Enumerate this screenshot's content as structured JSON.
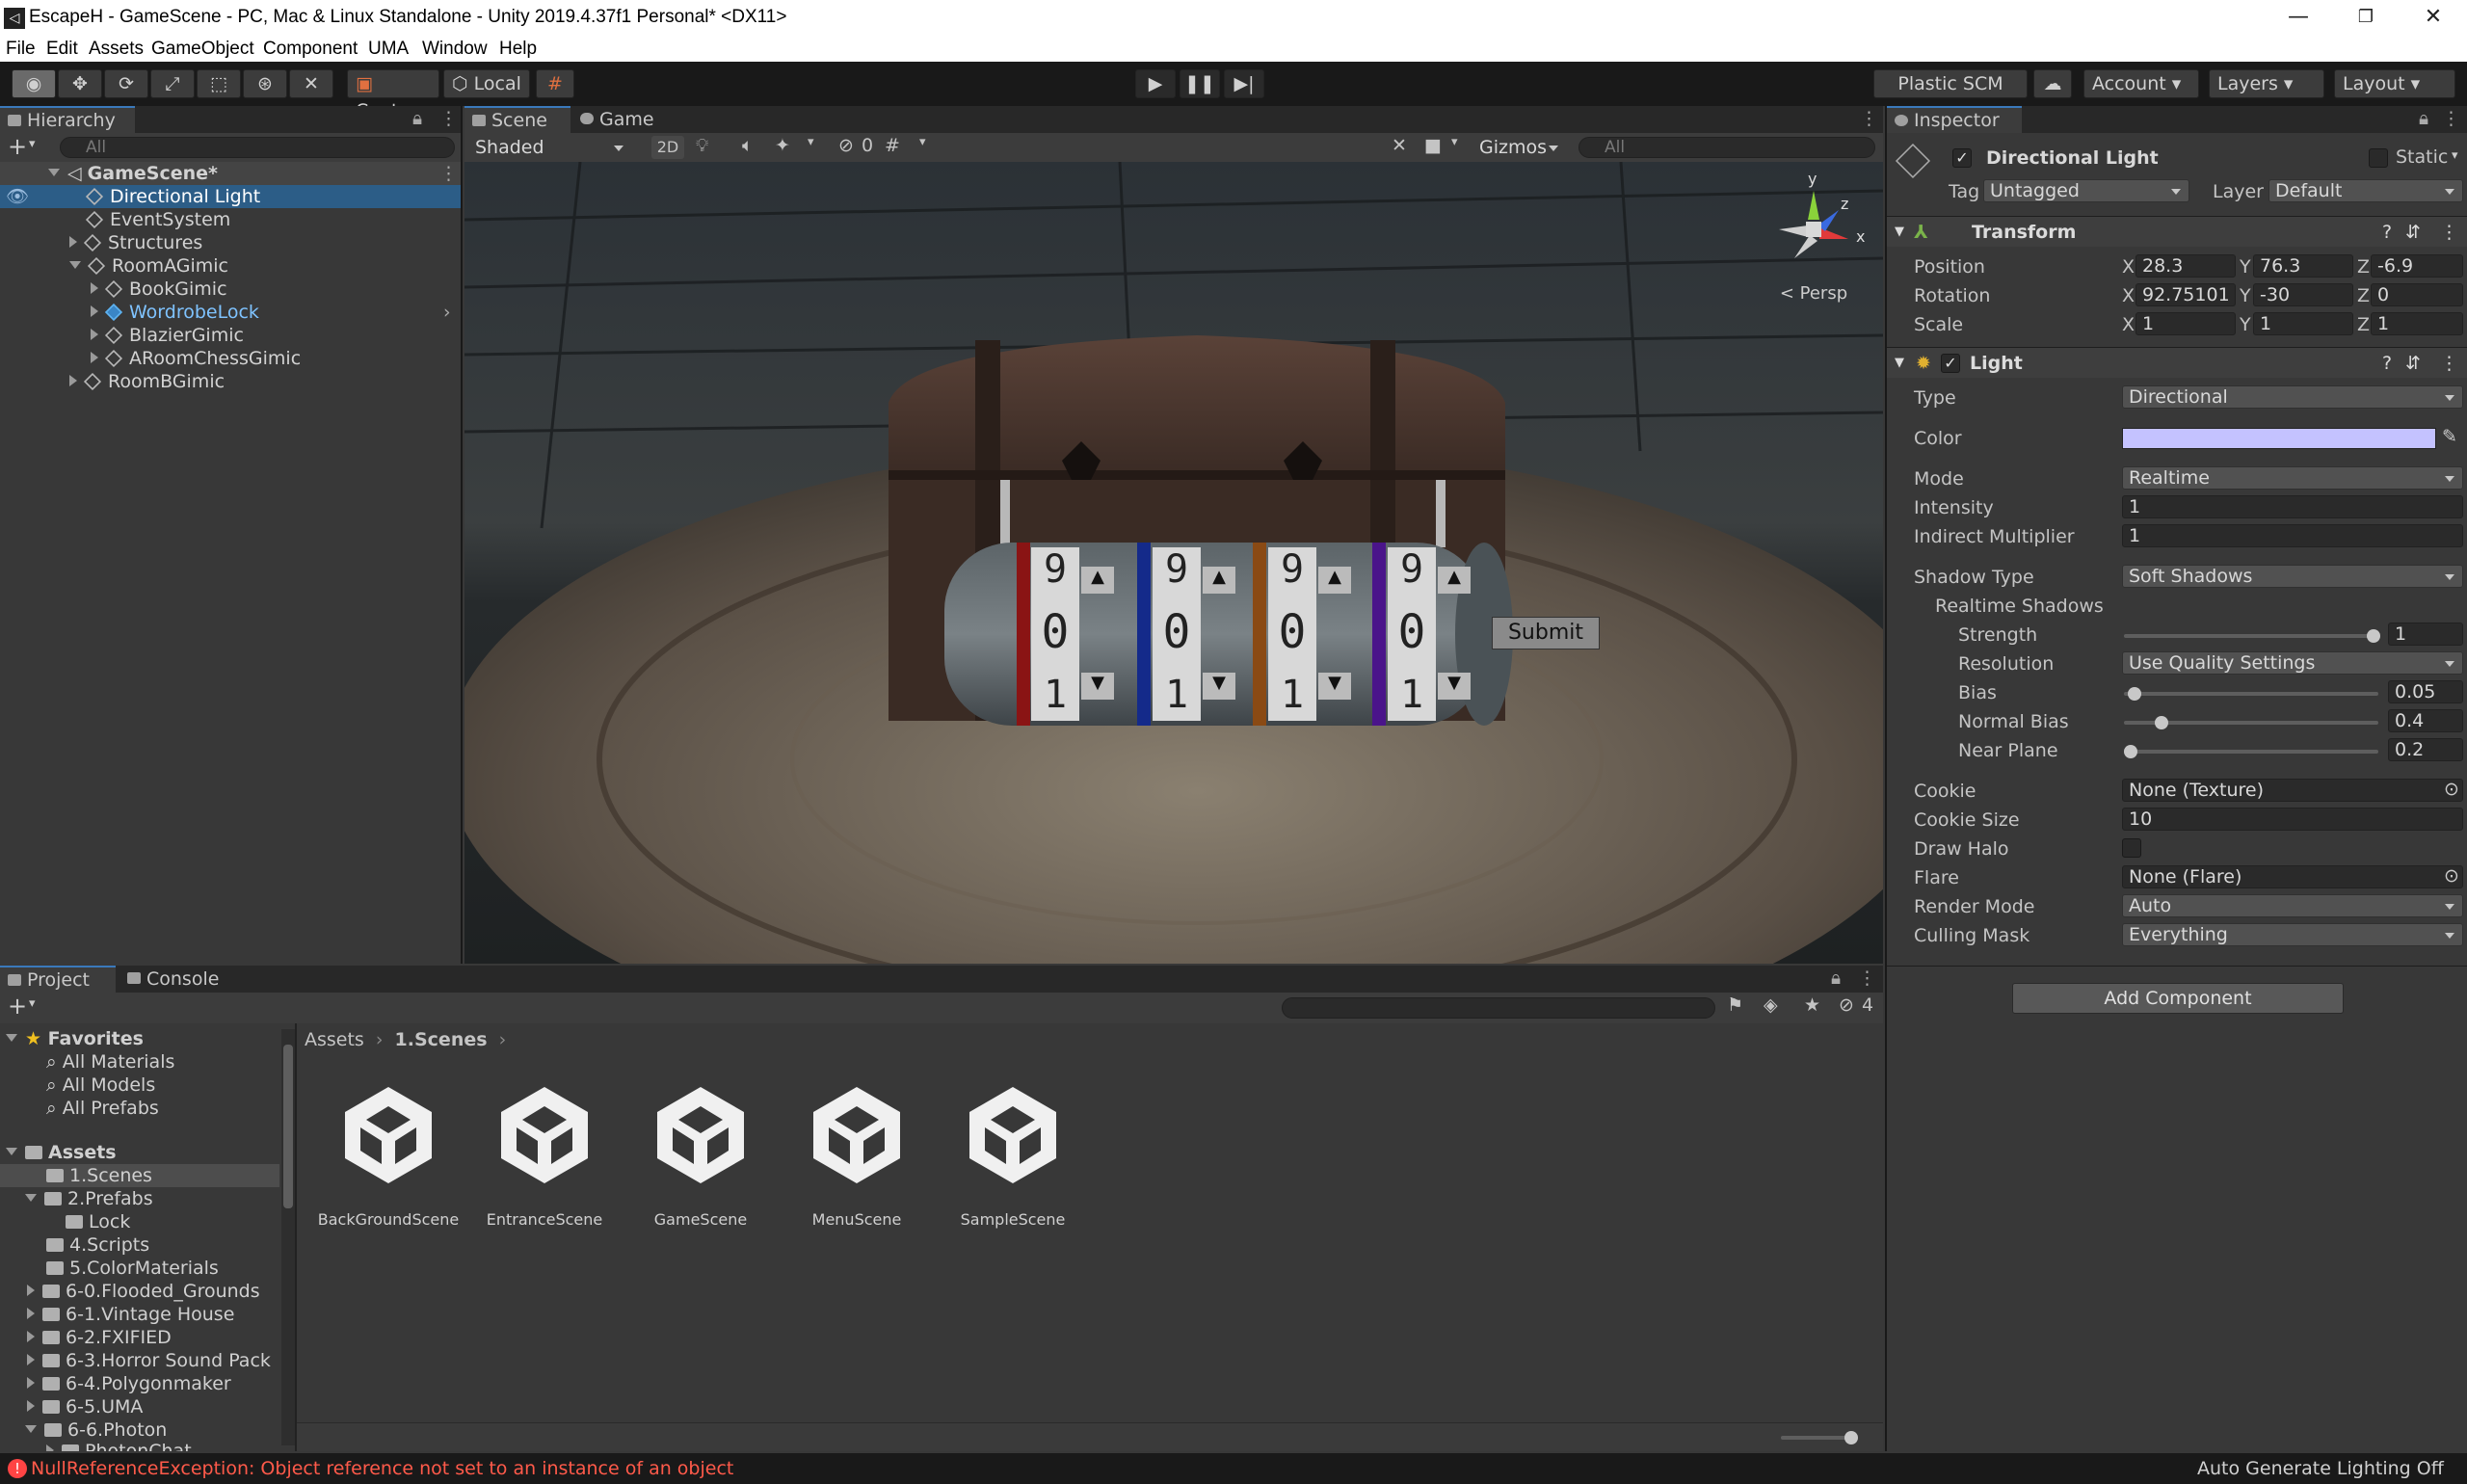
{
  "window": {
    "title": "EscapeH - GameScene - PC, Mac & Linux Standalone - Unity 2019.4.37f1 Personal* <DX11>",
    "minimize": "—",
    "maximize": "❐",
    "close": "✕"
  },
  "menu": [
    "File",
    "Edit",
    "Assets",
    "GameObject",
    "Component",
    "UMA",
    "Window",
    "Help"
  ],
  "toolbar": {
    "center_label": "Center",
    "local_label": "Local",
    "plastic_label": "Plastic SCM",
    "account_label": "Account",
    "layers_label": "Layers",
    "layout_label": "Layout"
  },
  "hierarchy": {
    "tab": "Hierarchy",
    "search_placeholder": "All",
    "rows": [
      {
        "label": "GameScene*"
      },
      {
        "label": "Directional Light"
      },
      {
        "label": "EventSystem"
      },
      {
        "label": "Structures"
      },
      {
        "label": "RoomAGimic"
      },
      {
        "label": "BookGimic"
      },
      {
        "label": "WordrobeLock"
      },
      {
        "label": "BlazierGimic"
      },
      {
        "label": "ARoomChessGimic"
      },
      {
        "label": "RoomBGimic"
      }
    ]
  },
  "scene": {
    "tab_scene": "Scene",
    "tab_game": "Game",
    "shading": "Shaded",
    "mode_2d": "2D",
    "hidden_count": "0",
    "gizmos": "Gizmos",
    "search_placeholder": "All",
    "persp": "< Persp",
    "axis_y": "y",
    "axis_z": "z",
    "axis_x": "x",
    "lock_digits": [
      "9",
      "0",
      "1"
    ],
    "submit_label": "Submit"
  },
  "inspector": {
    "tab": "Inspector",
    "object_name": "Directional Light",
    "static_label": "Static",
    "tag_label": "Tag",
    "tag_value": "Untagged",
    "layer_label": "Layer",
    "layer_value": "Default",
    "transform": {
      "title": "Transform",
      "position_label": "Position",
      "rotation_label": "Rotation",
      "scale_label": "Scale",
      "position": {
        "x": "28.3",
        "y": "76.3",
        "z": "-6.9"
      },
      "rotation": {
        "x": "92.75101",
        "y": "-30",
        "z": "0"
      },
      "scale": {
        "x": "1",
        "y": "1",
        "z": "1"
      }
    },
    "light": {
      "title": "Light",
      "type_label": "Type",
      "type_value": "Directional",
      "color_label": "Color",
      "color_value": "#c4c2ff",
      "mode_label": "Mode",
      "mode_value": "Realtime",
      "intensity_label": "Intensity",
      "intensity_value": "1",
      "indirect_label": "Indirect Multiplier",
      "indirect_value": "1",
      "shadow_type_label": "Shadow Type",
      "shadow_type_value": "Soft Shadows",
      "realtime_shadows_label": "Realtime Shadows",
      "strength_label": "Strength",
      "strength_value": "1",
      "resolution_label": "Resolution",
      "resolution_value": "Use Quality Settings",
      "bias_label": "Bias",
      "bias_value": "0.05",
      "normal_bias_label": "Normal Bias",
      "normal_bias_value": "0.4",
      "near_plane_label": "Near Plane",
      "near_plane_value": "0.2",
      "cookie_label": "Cookie",
      "cookie_value": "None (Texture)",
      "cookie_size_label": "Cookie Size",
      "cookie_size_value": "10",
      "draw_halo_label": "Draw Halo",
      "flare_label": "Flare",
      "flare_value": "None (Flare)",
      "render_mode_label": "Render Mode",
      "render_mode_value": "Auto",
      "culling_mask_label": "Culling Mask",
      "culling_mask_value": "Everything"
    },
    "add_component": "Add Component"
  },
  "project": {
    "tab_project": "Project",
    "tab_console": "Console",
    "hidden_count": "4",
    "favorites_label": "Favorites",
    "favorites": [
      "All Materials",
      "All Models",
      "All Prefabs"
    ],
    "assets_label": "Assets",
    "folders": [
      "1.Scenes",
      "2.Prefabs",
      "Lock",
      "4.Scripts",
      "5.ColorMaterials",
      "6-0.Flooded_Grounds",
      "6-1.Vintage House",
      "6-2.FXIFIED",
      "6-3.Horror Sound Pack",
      "6-4.Polygonmaker",
      "6-5.UMA",
      "6-6.Photon",
      "PhotonChat"
    ],
    "breadcrumb_root": "Assets",
    "breadcrumb_current": "1.Scenes",
    "scenes": [
      "BackGroundScene",
      "EntranceScene",
      "GameScene",
      "MenuScene",
      "SampleScene"
    ]
  },
  "status": {
    "error": "NullReferenceException: Object reference not set to an instance of an object",
    "right": "Auto Generate Lighting Off"
  }
}
